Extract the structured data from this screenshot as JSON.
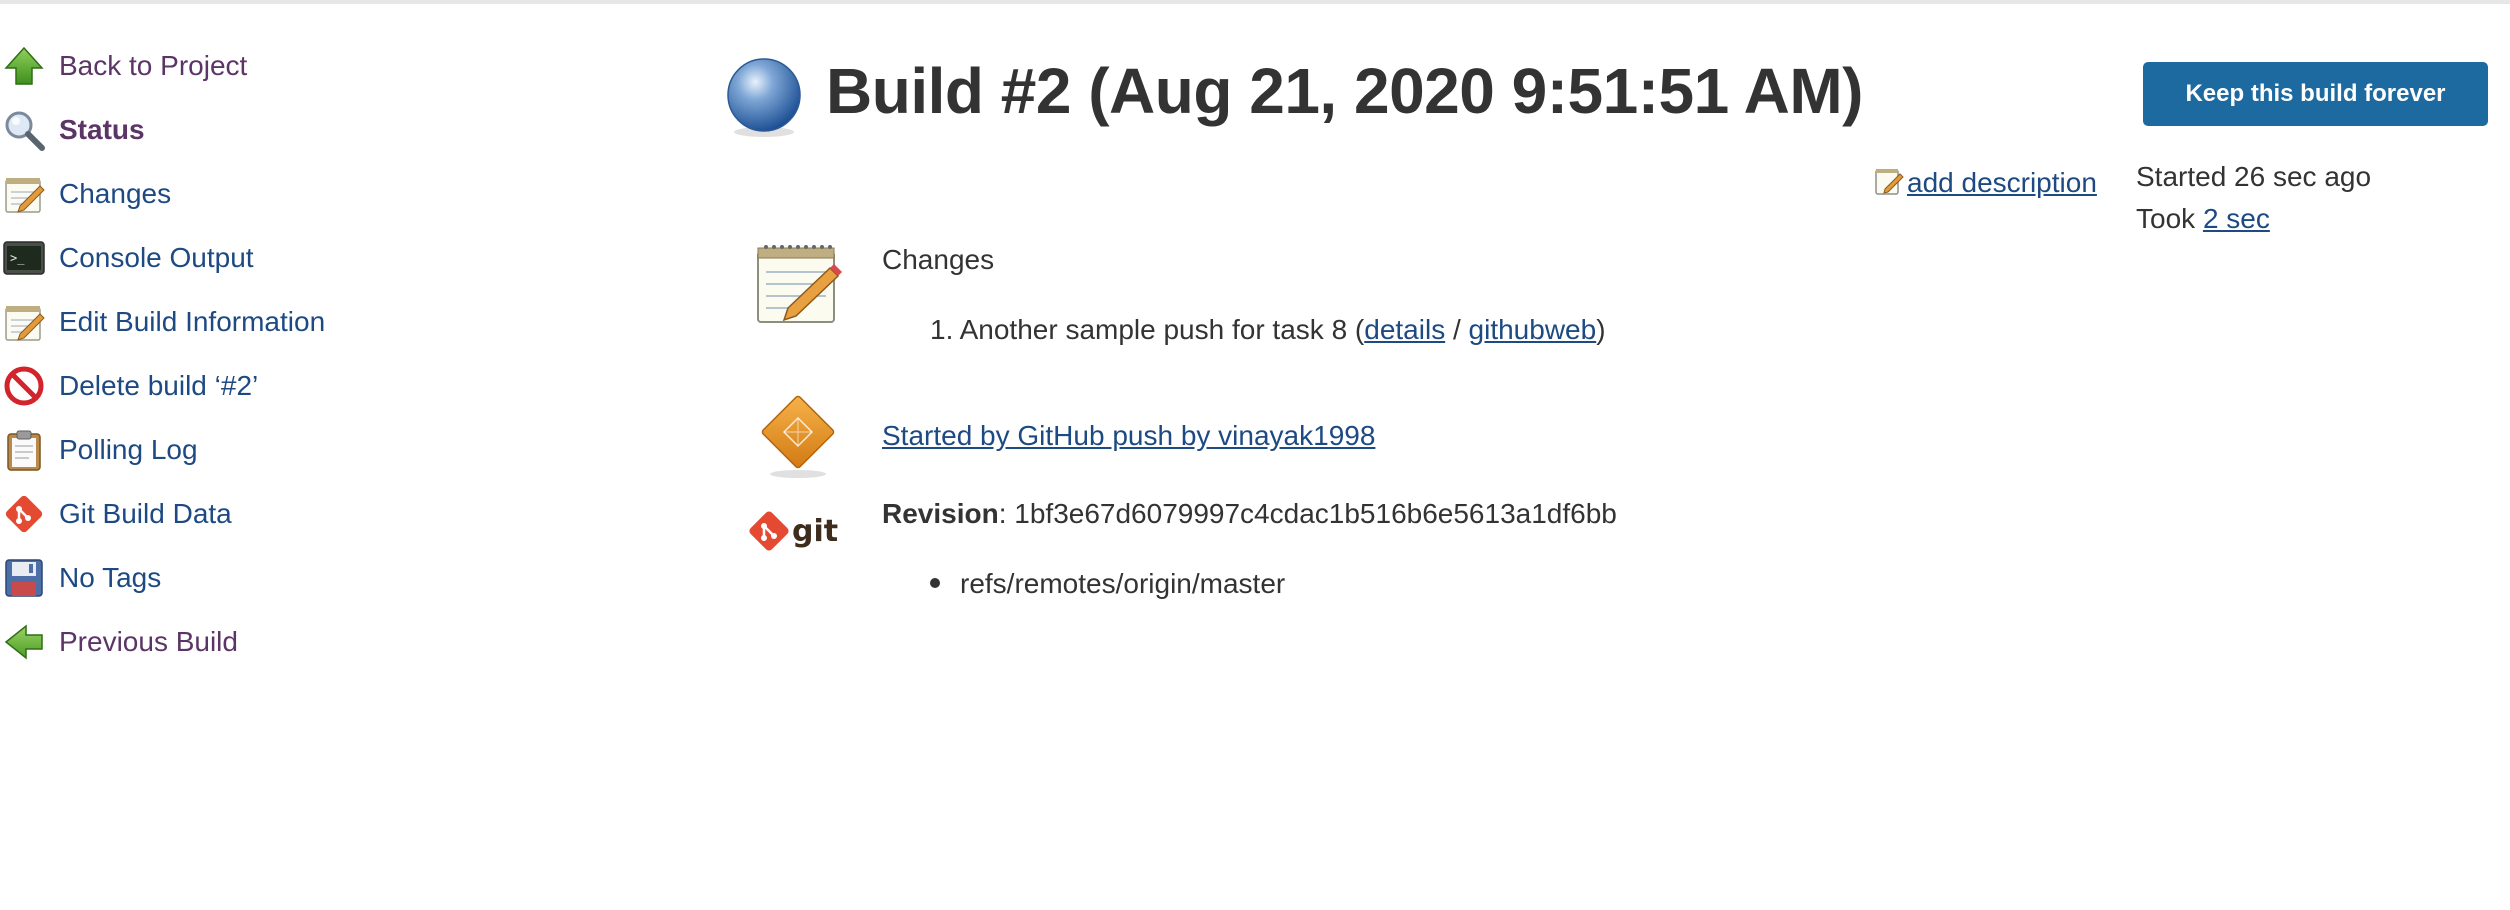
{
  "sidebar": {
    "items": [
      {
        "label": "Back to Project",
        "icon": "up-arrow-icon"
      },
      {
        "label": "Status",
        "icon": "magnifier-icon"
      },
      {
        "label": "Changes",
        "icon": "notepad-icon"
      },
      {
        "label": "Console Output",
        "icon": "terminal-icon"
      },
      {
        "label": "Edit Build Information",
        "icon": "notepad-icon"
      },
      {
        "label": "Delete build ‘#2’",
        "icon": "no-entry-icon"
      },
      {
        "label": "Polling Log",
        "icon": "clipboard-icon"
      },
      {
        "label": "Git Build Data",
        "icon": "git-icon"
      },
      {
        "label": "No Tags",
        "icon": "floppy-disk-icon"
      },
      {
        "label": "Previous Build",
        "icon": "left-arrow-icon"
      }
    ]
  },
  "header": {
    "title": "Build #2 (Aug 21, 2020 9:51:51 AM)",
    "status_icon": "blue-ball-icon",
    "keep_button_label": "Keep this build forever"
  },
  "description": {
    "add_label": "add description"
  },
  "meta": {
    "started_label": "Started 26 sec ago",
    "took_prefix": "Took",
    "took_value": "2 sec"
  },
  "changes": {
    "heading": "Changes",
    "items": [
      {
        "number": "1.",
        "message": "Another sample push for task 8",
        "details_label": "details",
        "separator": "/",
        "web_label": "githubweb"
      }
    ]
  },
  "cause": {
    "label": "Started by GitHub push by vinayak1998"
  },
  "git": {
    "revision_label": "Revision",
    "revision_value": "1bf3e67d6079997c4cdac1b516b6e5613a1df6bb",
    "branches": [
      "refs/remotes/origin/master"
    ]
  },
  "colors": {
    "link": "#1d4a82",
    "visited_link": "#5c3567",
    "button": "#1c6aa0",
    "text": "#333333"
  }
}
